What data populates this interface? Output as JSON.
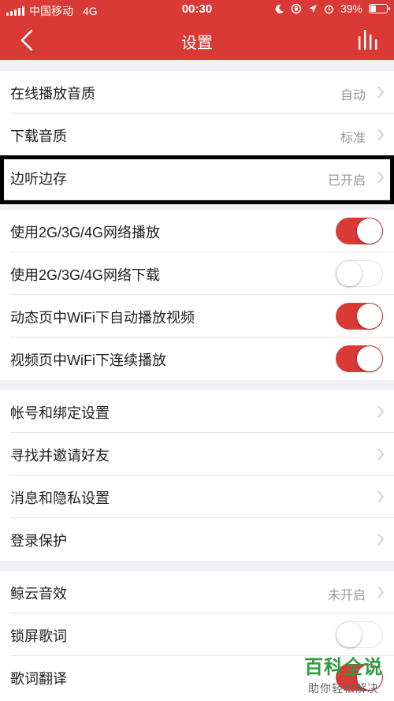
{
  "status_bar": {
    "carrier": "中国移动",
    "network": "4G",
    "time": "00:30",
    "battery": "39%",
    "battery_level": 0.39,
    "icons": [
      "moon-icon",
      "rotation-lock-icon",
      "location-icon",
      "alarm-icon"
    ]
  },
  "header": {
    "title": "设置",
    "back_icon": "chevron-left-icon",
    "right_icon": "equalizer-icon"
  },
  "sections": [
    {
      "rows": [
        {
          "label": "在线播放音质",
          "value": "自动",
          "type": "nav"
        },
        {
          "label": "下载音质",
          "value": "标准",
          "type": "nav"
        },
        {
          "label": "边听边存",
          "value": "已开启",
          "type": "nav"
        }
      ]
    },
    {
      "rows": [
        {
          "label": "使用2G/3G/4G网络播放",
          "type": "toggle",
          "on": true
        },
        {
          "label": "使用2G/3G/4G网络下载",
          "type": "toggle",
          "on": false
        },
        {
          "label": "动态页中WiFi下自动播放视频",
          "type": "toggle",
          "on": true
        },
        {
          "label": "视频页中WiFi下连续播放",
          "type": "toggle",
          "on": true
        }
      ]
    },
    {
      "rows": [
        {
          "label": "帐号和绑定设置",
          "type": "nav"
        },
        {
          "label": "寻找并邀请好友",
          "type": "nav"
        },
        {
          "label": "消息和隐私设置",
          "type": "nav"
        },
        {
          "label": "登录保护",
          "type": "nav"
        }
      ]
    },
    {
      "rows": [
        {
          "label": "鲸云音效",
          "value": "未开启",
          "type": "nav"
        },
        {
          "label": "锁屏歌词",
          "type": "toggle",
          "on": false
        },
        {
          "label": "歌词翻译",
          "type": "toggle",
          "on": true
        }
      ]
    }
  ],
  "watermark": {
    "title": "百科全说",
    "subtitle": "助你轻松解决"
  },
  "colors": {
    "accent": "#d93a35",
    "background": "#efeff4",
    "secondary_text": "#999999"
  }
}
